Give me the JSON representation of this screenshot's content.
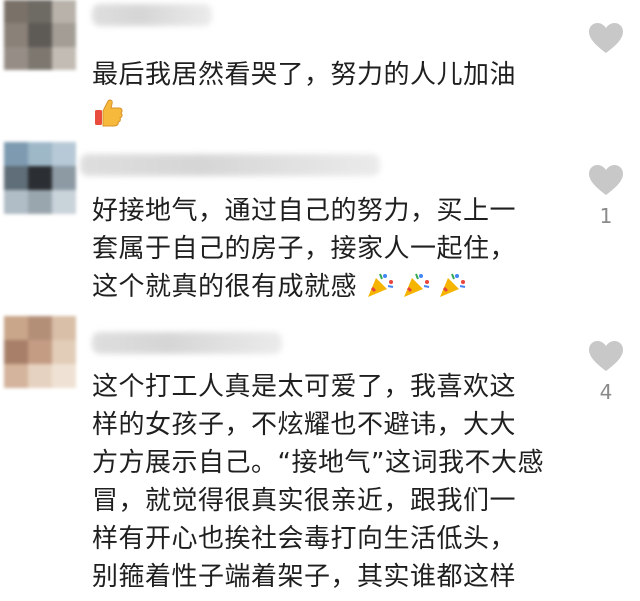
{
  "comments": [
    {
      "text_lines": [
        "最后我居然看哭了，努力的人儿加油"
      ],
      "emoji": "thumbs-up-icon",
      "likes": ""
    },
    {
      "text_lines": [
        "好接地气，通过自己的努力，买上一",
        "套属于自己的房子，接家人一起住，",
        "这个就真的很有成就感"
      ],
      "emoji": "party-popper-icon",
      "likes": "1"
    },
    {
      "text_lines": [
        "这个打工人真是太可爱了，我喜欢这",
        "样的女孩子，不炫耀也不避讳，大大",
        "方方展示自己。“接地气”这词我不大感",
        "冒，就觉得很真实很亲近，跟我们一",
        "样有开心也挨社会毒打向生活低头，",
        "别箍着性子端着架子，其实谁都这样"
      ],
      "emoji": "",
      "likes": "4"
    }
  ],
  "colors": {
    "heart": "#c8c8c8",
    "text": "#1f1f1f",
    "count": "#8a8a8a"
  }
}
